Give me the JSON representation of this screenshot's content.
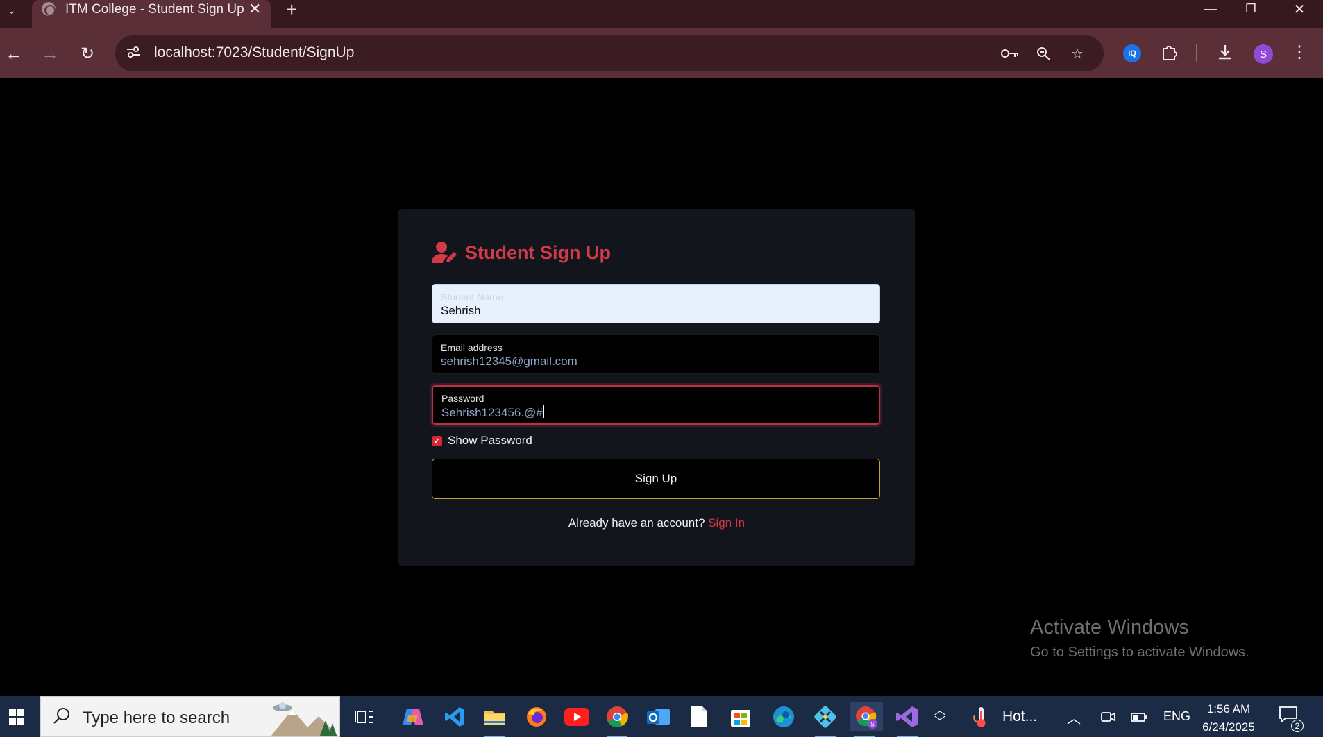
{
  "browser": {
    "tab_title": "ITM College - Student Sign Up",
    "url": "localhost:7023/Student/SignUp",
    "profile_initial": "S",
    "extension_badge": "IQ",
    "window_controls": {
      "minimize": "—",
      "restore": "❐",
      "close": "✕"
    }
  },
  "page": {
    "heading": "Student Sign Up",
    "fields": {
      "name": {
        "label": "Student Name",
        "value": "Sehrish"
      },
      "email": {
        "label": "Email address",
        "value": "sehrish12345@gmail.com"
      },
      "password": {
        "label": "Password",
        "value": "Sehrish123456.@#"
      }
    },
    "show_password": {
      "label": "Show Password",
      "checked": true
    },
    "submit_label": "Sign Up",
    "signin_prompt": "Already have an account?",
    "signin_link": "Sign In"
  },
  "watermark": {
    "title": "Activate Windows",
    "subtitle": "Go to Settings to activate Windows."
  },
  "taskbar": {
    "search_placeholder": "Type here to search",
    "weather_label": "Hot...",
    "language": "ENG",
    "time": "1:56 AM",
    "date": "6/24/2025",
    "notification_count": "2"
  },
  "colors": {
    "accent": "#d23a4a",
    "button_border": "#c9a227",
    "card_bg": "#12151b",
    "chrome_tab": "#5a2f37",
    "chrome_strip": "#35191f",
    "taskbar": "#1b2a45"
  }
}
